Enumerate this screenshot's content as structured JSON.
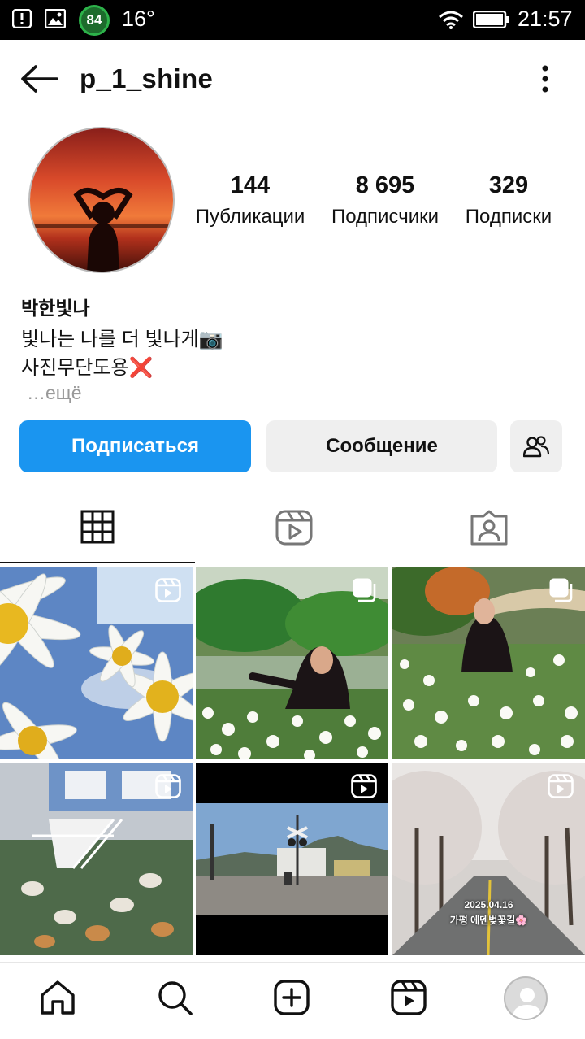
{
  "status_bar": {
    "temperature": "16°",
    "battery_badge": "84",
    "time": "21:57"
  },
  "header": {
    "username": "p_1_shine"
  },
  "profile": {
    "stats": [
      {
        "value": "144",
        "label": "Публикации"
      },
      {
        "value": "8 695",
        "label": "Подписчики"
      },
      {
        "value": "329",
        "label": "Подписки"
      }
    ],
    "name": "박한빛나",
    "bio_lines": [
      "빛나는 나를 더 빛나게📷",
      "사진무단도용❌"
    ],
    "more": "…ещё"
  },
  "actions": {
    "follow": "Подписаться",
    "message": "Сообщение"
  },
  "tabs": [
    {
      "icon": "grid-icon",
      "active": true
    },
    {
      "icon": "reels-icon",
      "active": false
    },
    {
      "icon": "tagged-icon",
      "active": false
    }
  ],
  "posts": [
    {
      "icon": "reels-icon",
      "scene": "daisies and blue sky"
    },
    {
      "icon": "carousel-icon",
      "scene": "girl in daisy field"
    },
    {
      "icon": "carousel-icon",
      "scene": "girl in flower garden"
    },
    {
      "icon": "reels-icon",
      "scene": "cats near blue house"
    },
    {
      "icon": "reels-icon",
      "scene": "railway crossing"
    },
    {
      "icon": "reels-icon",
      "scene": "cherry blossom road",
      "caption_date": "2025.04.16",
      "caption_text": "가평 에덴벚꽃길🌸"
    }
  ],
  "bottom_nav": [
    {
      "icon": "home-icon"
    },
    {
      "icon": "search-icon"
    },
    {
      "icon": "create-icon"
    },
    {
      "icon": "reels-icon"
    },
    {
      "icon": "profile-avatar-icon"
    }
  ],
  "colors": {
    "accent": "#1a95f0",
    "button_gray": "#efefef"
  }
}
